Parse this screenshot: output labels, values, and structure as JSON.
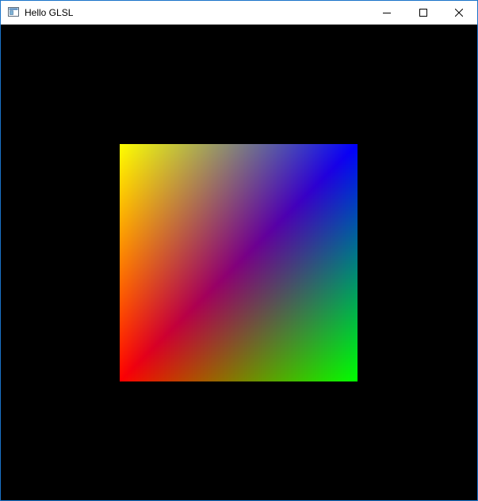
{
  "window": {
    "title": "Hello GLSL",
    "controls": {
      "minimize_icon": "minimize-icon",
      "maximize_icon": "maximize-icon",
      "close_icon": "close-icon"
    }
  },
  "scene": {
    "background_color": "#000000",
    "quad_corner_colors": {
      "top_left": "#ffff00",
      "top_right": "#0000ff",
      "bottom_left": "#ff0000",
      "bottom_right": "#00ff00"
    }
  }
}
